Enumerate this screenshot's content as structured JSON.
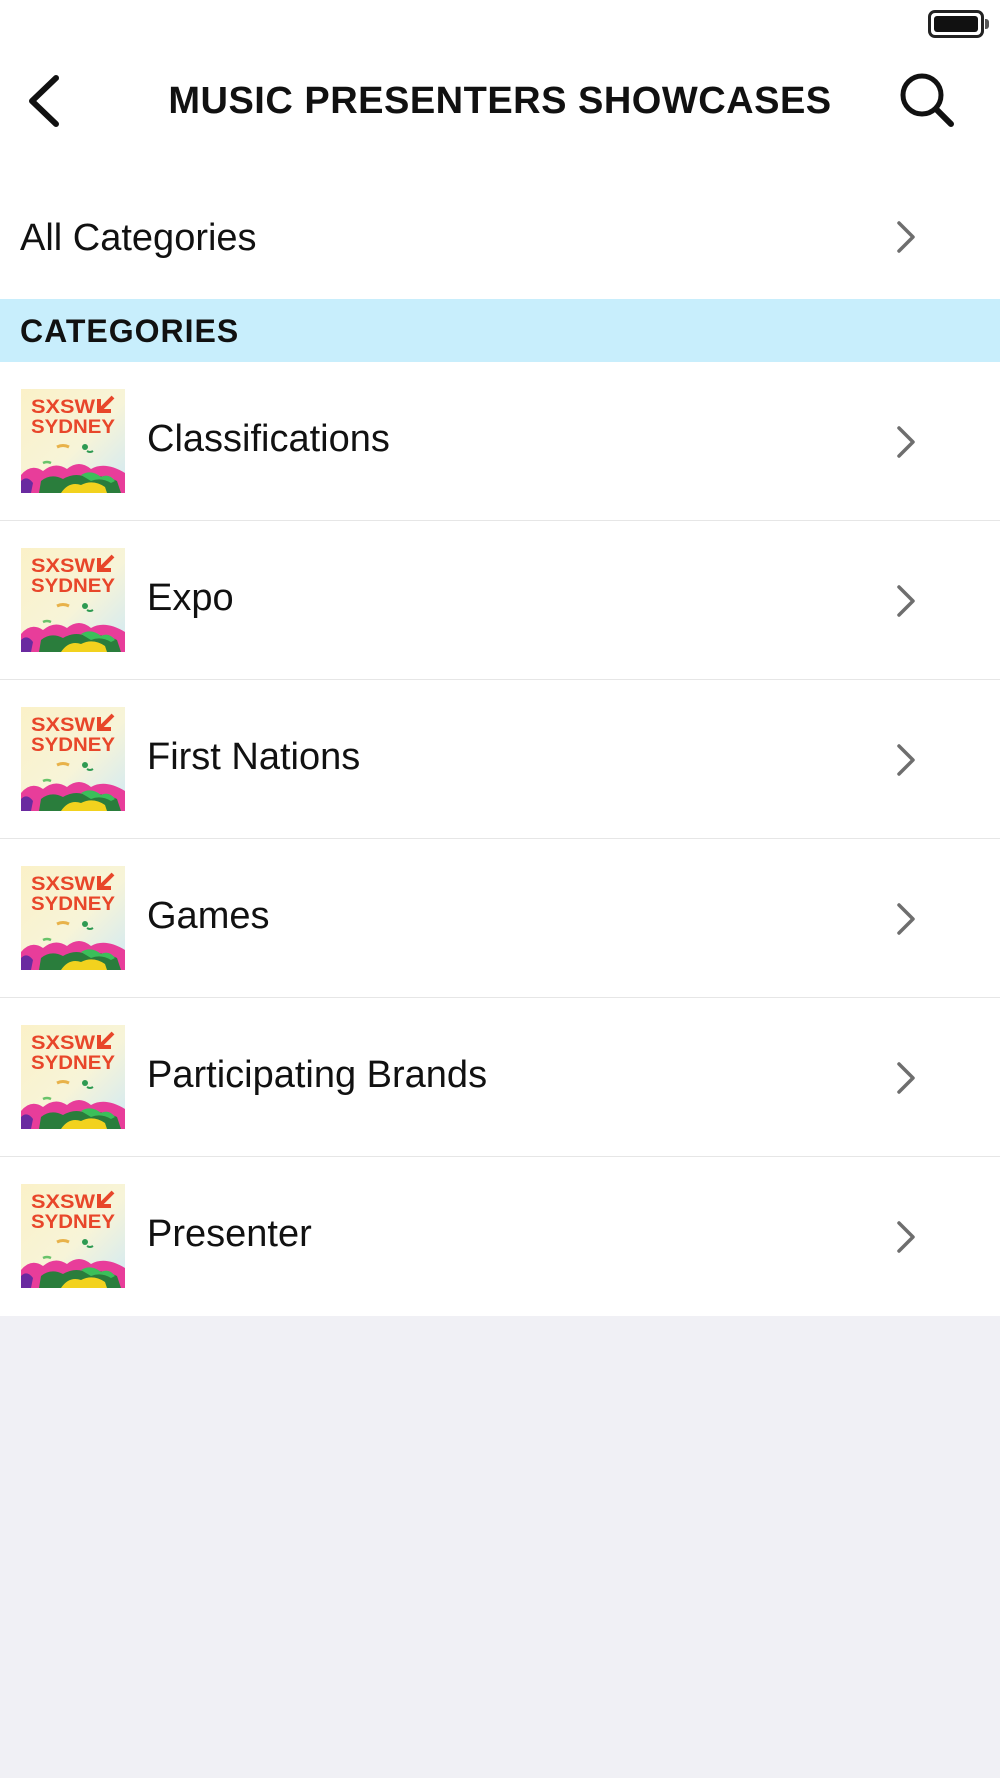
{
  "header": {
    "title": "MUSIC PRESENTERS SHOWCASES",
    "back_icon": "chevron-left-icon",
    "search_icon": "search-icon"
  },
  "all_categories": {
    "label": "All Categories"
  },
  "section": {
    "label": "CATEGORIES"
  },
  "thumbnail": {
    "line1": "SXSW",
    "line2": "SYDNEY"
  },
  "categories": [
    {
      "label": "Classifications"
    },
    {
      "label": "Expo"
    },
    {
      "label": "First Nations"
    },
    {
      "label": "Games"
    },
    {
      "label": "Participating Brands"
    },
    {
      "label": "Presenter"
    }
  ],
  "colors": {
    "section_header_bg": "#c8eefc",
    "page_bg": "#f0f0f5",
    "logo_orange": "#e8462a"
  }
}
